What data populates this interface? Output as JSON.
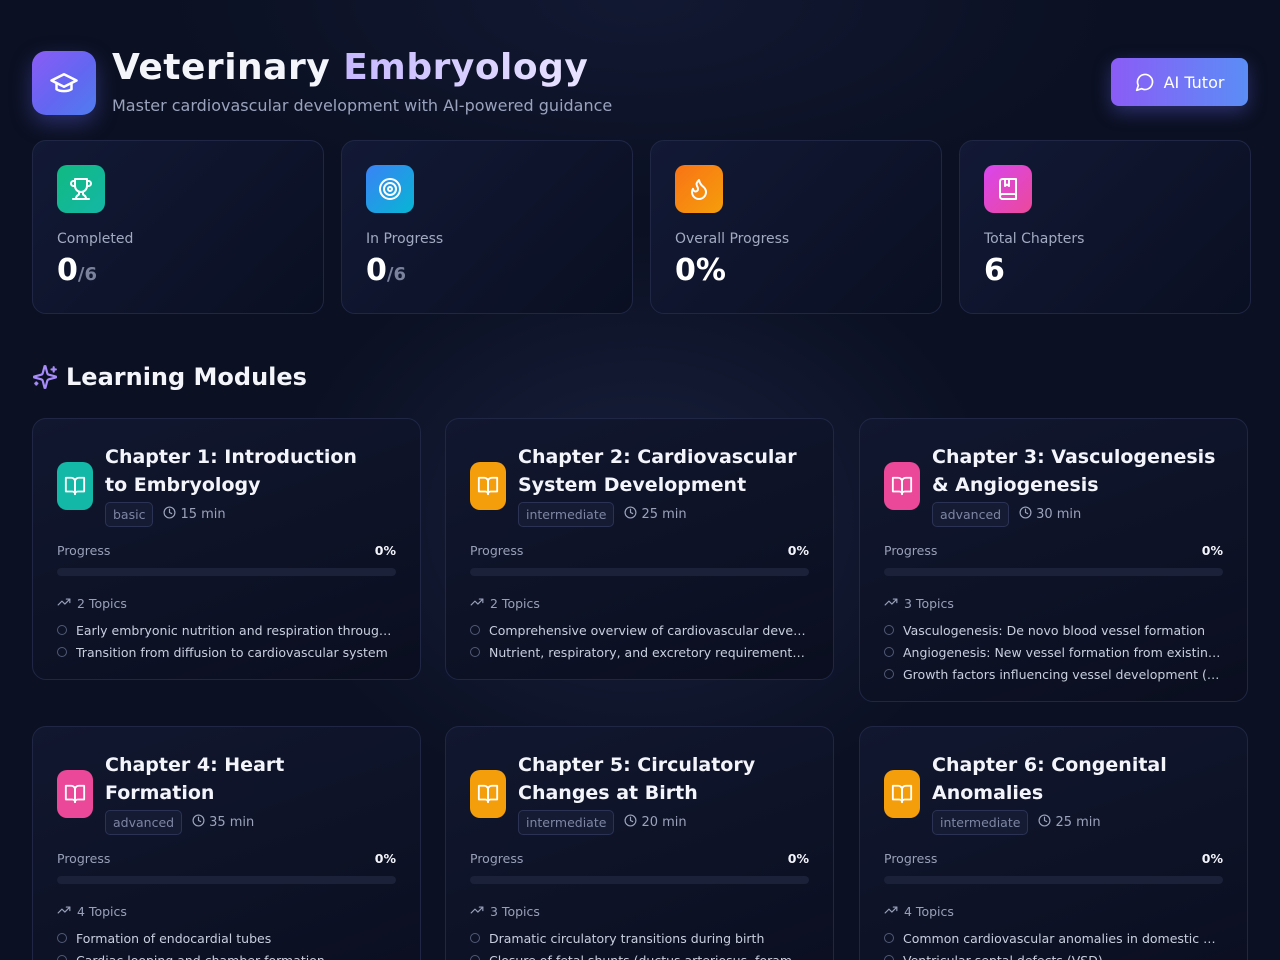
{
  "header": {
    "title_part1": "Veterinary",
    "title_part2": "Embryology",
    "subtitle": "Master cardiovascular development with AI-powered guidance",
    "ai_button": "AI Tutor"
  },
  "stats": [
    {
      "label": "Completed",
      "value": "0",
      "sub": "/6",
      "icon": "trophy-icon"
    },
    {
      "label": "In Progress",
      "value": "0",
      "sub": "/6",
      "icon": "target-icon"
    },
    {
      "label": "Overall Progress",
      "value": "0%",
      "sub": "",
      "icon": "flame-icon"
    },
    {
      "label": "Total Chapters",
      "value": "6",
      "sub": "",
      "icon": "bookmark-book-icon"
    }
  ],
  "section_title": "Learning Modules",
  "progress_label": "Progress",
  "modules": [
    {
      "title": "Chapter 1: Introduction to Embryology",
      "level": "basic",
      "duration": "15 min",
      "progress": "0%",
      "progress_fraction": 0,
      "topics_label": "2 Topics",
      "topics": [
        "Early embryonic nutrition and respiration through diffusion",
        "Transition from diffusion to cardiovascular system"
      ],
      "color": "#14b8a6"
    },
    {
      "title": "Chapter 2: Cardiovascular System Development",
      "level": "intermediate",
      "duration": "25 min",
      "progress": "0%",
      "progress_fraction": 0,
      "topics_label": "2 Topics",
      "topics": [
        "Comprehensive overview of cardiovascular development",
        "Nutrient, respiratory, and excretory requirements in embryo"
      ],
      "color": "#f59e0b"
    },
    {
      "title": "Chapter 3: Vasculogenesis & Angiogenesis",
      "level": "advanced",
      "duration": "30 min",
      "progress": "0%",
      "progress_fraction": 0,
      "topics_label": "3 Topics",
      "topics": [
        "Vasculogenesis: De novo blood vessel formation",
        "Angiogenesis: New vessel formation from existing vessels",
        "Growth factors influencing vessel development (VEGF)"
      ],
      "color": "#ec4899"
    },
    {
      "title": "Chapter 4: Heart Formation",
      "level": "advanced",
      "duration": "35 min",
      "progress": "0%",
      "progress_fraction": 0,
      "topics_label": "4 Topics",
      "topics": [
        "Formation of endocardial tubes",
        "Cardiac looping and chamber formation"
      ],
      "color": "#ec4899"
    },
    {
      "title": "Chapter 5: Circulatory Changes at Birth",
      "level": "intermediate",
      "duration": "20 min",
      "progress": "0%",
      "progress_fraction": 0,
      "topics_label": "3 Topics",
      "topics": [
        "Dramatic circulatory transitions during birth",
        "Closure of fetal shunts (ductus arteriosus, foramen ovale)"
      ],
      "color": "#f59e0b"
    },
    {
      "title": "Chapter 6: Congenital Anomalies",
      "level": "intermediate",
      "duration": "25 min",
      "progress": "0%",
      "progress_fraction": 0,
      "topics_label": "4 Topics",
      "topics": [
        "Common cardiovascular anomalies in domestic animals",
        "Ventricular septal defects (VSD)"
      ],
      "color": "#f59e0b"
    }
  ],
  "colors": {
    "background": "#0b1022",
    "accent": "#6366f1",
    "completed": "#10b981",
    "in_progress": "#3b82f6",
    "overall": "#f97316",
    "chapters": "#d946ef"
  }
}
